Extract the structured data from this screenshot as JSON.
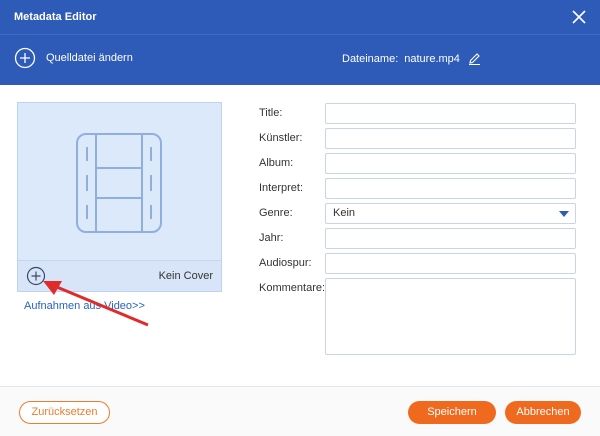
{
  "window": {
    "title": "Metadata Editor"
  },
  "toolbar": {
    "change_source_label": "Quelldatei ändern",
    "filename_label": "Dateiname:",
    "filename_value": "nature.mp4"
  },
  "cover": {
    "no_cover_label": "Kein Cover",
    "capture_link": "Aufnahmen aus Video>>"
  },
  "fields": {
    "title_label": "Title:",
    "artist_label": "Künstler:",
    "album_label": "Album:",
    "performer_label": "Interpret:",
    "genre_label": "Genre:",
    "genre_value": "Kein",
    "year_label": "Jahr:",
    "track_label": "Audiospur:",
    "comments_label": "Kommentare:"
  },
  "footer": {
    "reset_label": "Zurücksetzen",
    "save_label": "Speichern",
    "cancel_label": "Abbrechen"
  },
  "colors": {
    "header": "#2e5bb7",
    "accent": "#ef6a1f",
    "cover_bg": "#dce9fb"
  }
}
